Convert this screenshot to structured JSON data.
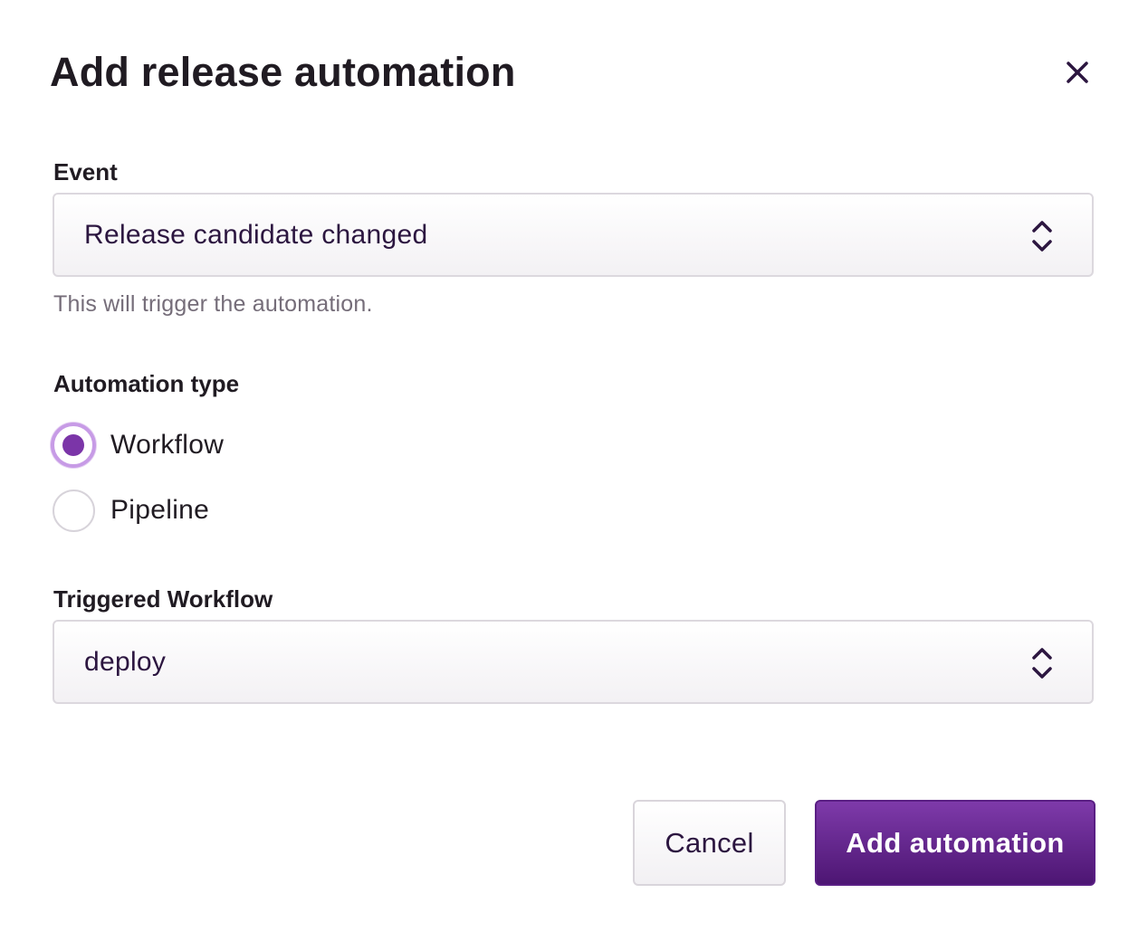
{
  "dialog": {
    "title": "Add release automation",
    "close_icon": "close-icon"
  },
  "event": {
    "label": "Event",
    "selected": "Release candidate changed",
    "helper": "This will trigger the automation."
  },
  "automation_type": {
    "label": "Automation type",
    "options": [
      {
        "label": "Workflow",
        "checked": true
      },
      {
        "label": "Pipeline",
        "checked": false
      }
    ]
  },
  "triggered_workflow": {
    "label": "Triggered Workflow",
    "selected": "deploy"
  },
  "actions": {
    "cancel_label": "Cancel",
    "submit_label": "Add automation"
  },
  "colors": {
    "accent": "#7b35a8",
    "primary_button": "#5f2187",
    "text": "#201b22",
    "select_text": "#2c1640",
    "helper_text": "#756d79"
  }
}
